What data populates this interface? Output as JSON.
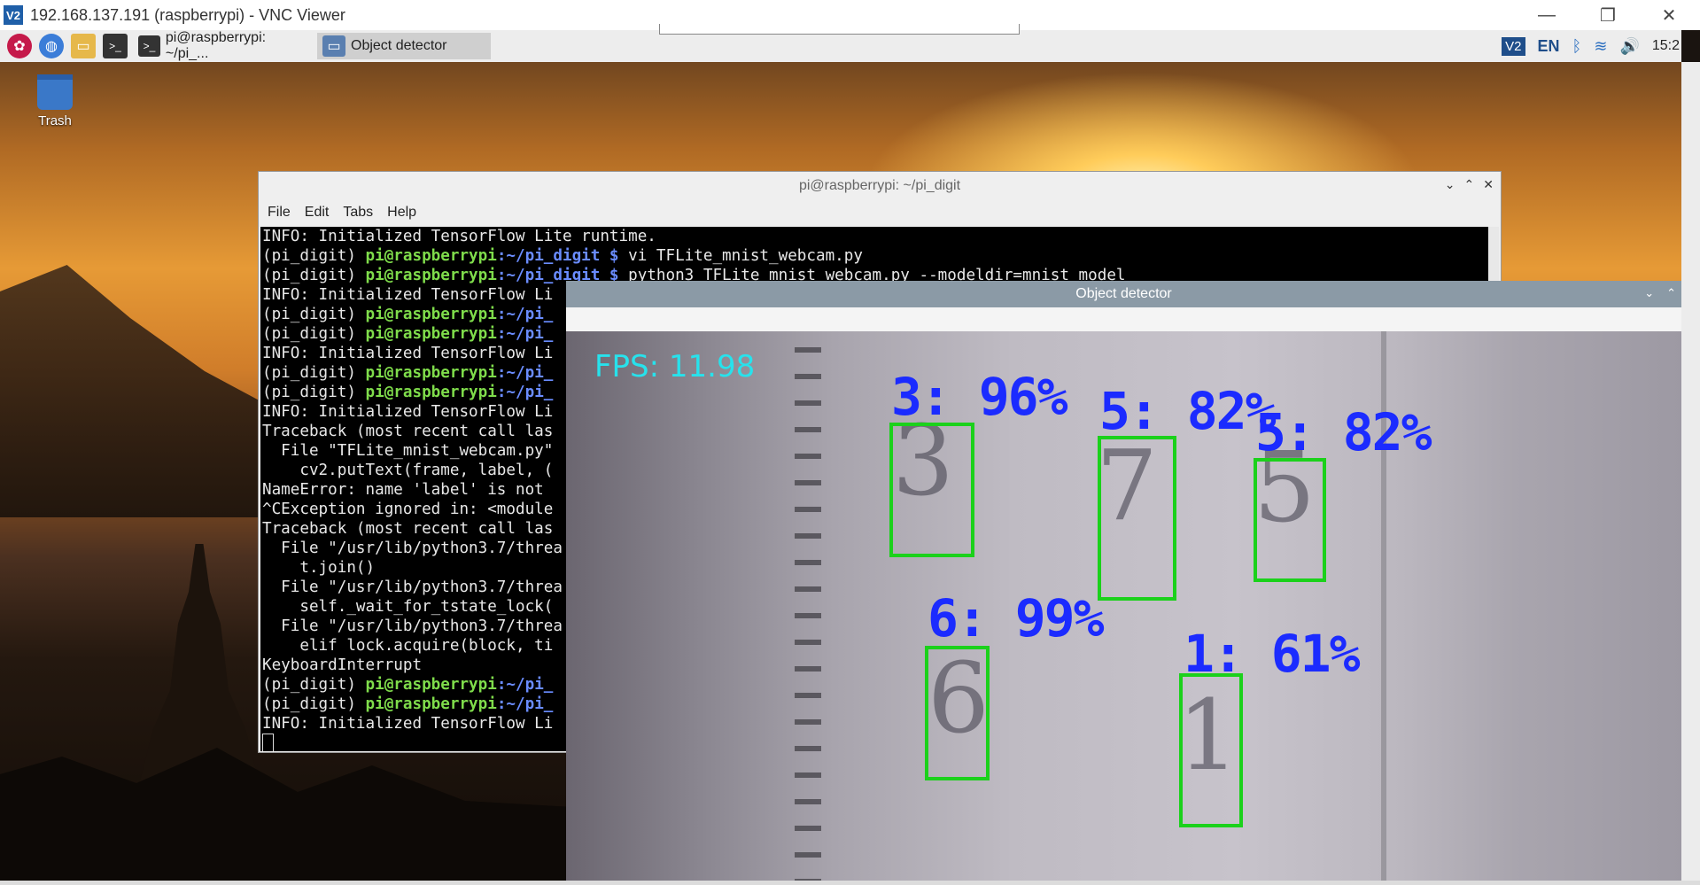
{
  "vnc": {
    "logo": "V2",
    "title": "192.168.137.191 (raspberrypi) - VNC Viewer",
    "minimize": "—",
    "restore": "❐",
    "close": "✕"
  },
  "taskbar": {
    "tasks": [
      {
        "label": "pi@raspberrypi: ~/pi_..."
      },
      {
        "label": "Object detector"
      }
    ],
    "tray": {
      "vnc": "V2",
      "lang": "EN",
      "bluetooth": "ᛒ",
      "wifi": "≋",
      "volume": "🔊",
      "time": "15:2"
    }
  },
  "desktop": {
    "trash_label": "Trash"
  },
  "terminal": {
    "title": "pi@raspberrypi: ~/pi_digit",
    "menu": [
      "File",
      "Edit",
      "Tabs",
      "Help"
    ],
    "lines": [
      {
        "kind": "plain",
        "text": "INFO: Initialized TensorFlow Lite runtime."
      },
      {
        "kind": "prompt",
        "env": "(pi_digit) ",
        "user": "pi@raspberrypi",
        "path": ":~/pi_digit $",
        "cmd": " vi TFLite_mnist_webcam.py"
      },
      {
        "kind": "prompt",
        "env": "(pi_digit) ",
        "user": "pi@raspberrypi",
        "path": ":~/pi_digit $",
        "cmd": " python3 TFLite_mnist_webcam.py --modeldir=mnist_model"
      },
      {
        "kind": "plain",
        "text": "INFO: Initialized TensorFlow Li"
      },
      {
        "kind": "prompt",
        "env": "(pi_digit) ",
        "user": "pi@raspberrypi",
        "path": ":~/pi_",
        "cmd": ""
      },
      {
        "kind": "prompt",
        "env": "(pi_digit) ",
        "user": "pi@raspberrypi",
        "path": ":~/pi_",
        "cmd": ""
      },
      {
        "kind": "plain",
        "text": "INFO: Initialized TensorFlow Li"
      },
      {
        "kind": "prompt",
        "env": "(pi_digit) ",
        "user": "pi@raspberrypi",
        "path": ":~/pi_",
        "cmd": ""
      },
      {
        "kind": "prompt",
        "env": "(pi_digit) ",
        "user": "pi@raspberrypi",
        "path": ":~/pi_",
        "cmd": ""
      },
      {
        "kind": "plain",
        "text": "INFO: Initialized TensorFlow Li"
      },
      {
        "kind": "plain",
        "text": "Traceback (most recent call las"
      },
      {
        "kind": "plain",
        "text": "  File \"TFLite_mnist_webcam.py\""
      },
      {
        "kind": "plain",
        "text": "    cv2.putText(frame, label, ("
      },
      {
        "kind": "plain",
        "text": "NameError: name 'label' is not"
      },
      {
        "kind": "plain",
        "text": "^CException ignored in: <module"
      },
      {
        "kind": "plain",
        "text": "Traceback (most recent call las"
      },
      {
        "kind": "plain",
        "text": "  File \"/usr/lib/python3.7/threa"
      },
      {
        "kind": "plain",
        "text": "    t.join()"
      },
      {
        "kind": "plain",
        "text": "  File \"/usr/lib/python3.7/threa"
      },
      {
        "kind": "plain",
        "text": "    self._wait_for_tstate_lock("
      },
      {
        "kind": "plain",
        "text": "  File \"/usr/lib/python3.7/threa"
      },
      {
        "kind": "plain",
        "text": "    elif lock.acquire(block, ti"
      },
      {
        "kind": "plain",
        "text": "KeyboardInterrupt"
      },
      {
        "kind": "prompt",
        "env": "(pi_digit) ",
        "user": "pi@raspberrypi",
        "path": ":~/pi_",
        "cmd": ""
      },
      {
        "kind": "prompt",
        "env": "(pi_digit) ",
        "user": "pi@raspberrypi",
        "path": ":~/pi_",
        "cmd": ""
      },
      {
        "kind": "plain",
        "text": "INFO: Initialized TensorFlow Li"
      }
    ]
  },
  "detector": {
    "title": "Object detector",
    "fps": "FPS: 11.98",
    "detections": [
      {
        "label": "3: 96%"
      },
      {
        "label": "5: 82%"
      },
      {
        "label": "5: 82%"
      },
      {
        "label": "6: 99%"
      },
      {
        "label": "1: 61%"
      }
    ]
  }
}
